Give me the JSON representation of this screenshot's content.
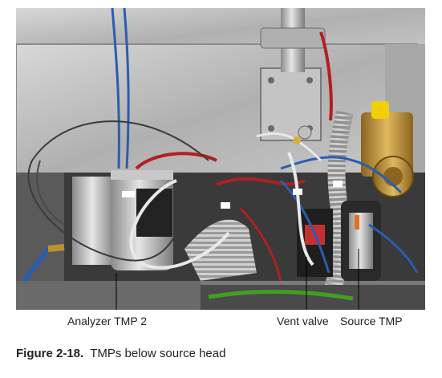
{
  "figure": {
    "callouts": {
      "analyzer_tmp2": "Analyzer TMP 2",
      "vent_valve": "Vent valve",
      "source_tmp": "Source TMP"
    },
    "caption_number": "Figure 2-18.",
    "caption_text": "TMPs below source head"
  },
  "colors": {
    "steel": "#b8b8b8",
    "dark_housing": "#2a2a2a",
    "red_wire": "#b02020",
    "blue_wire": "#2a5db0",
    "brass": "#c09030",
    "yellow_cap": "#f0d000",
    "green_cable": "#40a020"
  }
}
